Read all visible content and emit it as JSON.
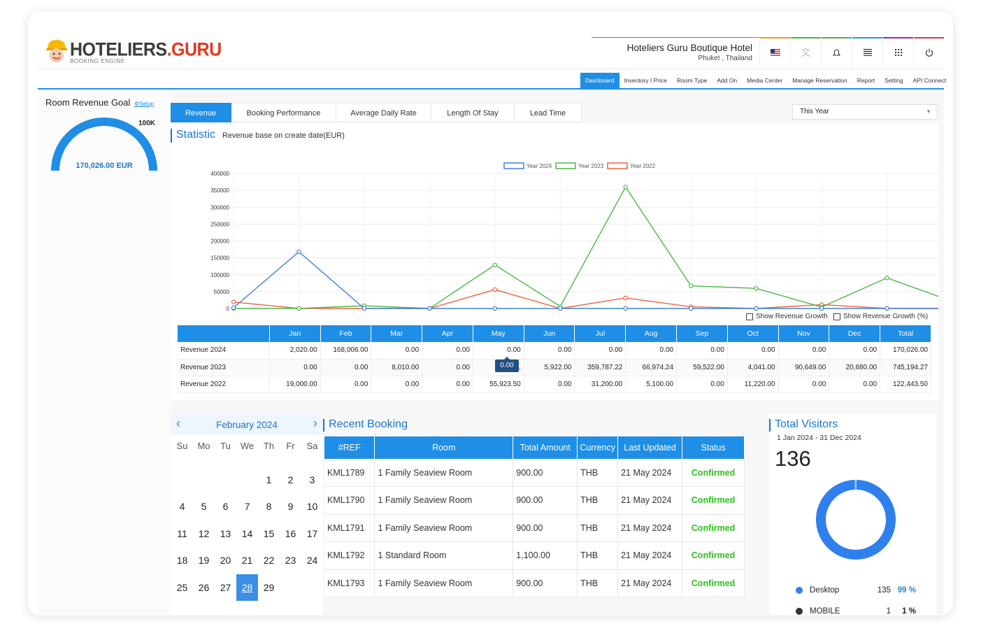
{
  "brand": {
    "name_a": "HOTELIERS",
    "name_b": ".GURU",
    "subtitle": "BOOKING ENGINE"
  },
  "hotel": {
    "name": "Hoteliers Guru Boutique Hotel",
    "location": "Phuket , Thailand"
  },
  "header_icons": [
    {
      "icon": "flag-icon",
      "bar": "#ff9800"
    },
    {
      "icon": "translate-icon",
      "bar": "#4caf50"
    },
    {
      "icon": "bell-icon",
      "bar": "#4caf50"
    },
    {
      "icon": "list-icon",
      "bar": "#2196f3"
    },
    {
      "icon": "apps-grid-icon",
      "bar": "#9c27b0"
    },
    {
      "icon": "power-icon",
      "bar": "#e53935"
    }
  ],
  "nav": [
    "Dashboard",
    "Inventory I Price",
    "Room Type",
    "Add On",
    "Media Center",
    "Manage Reservation",
    "Report",
    "Setting",
    "API Connect"
  ],
  "goal": {
    "title": "Room Revenue Goal",
    "setup": "Setup",
    "max_label": "100K",
    "value_label": "170,026.00 EUR"
  },
  "tabs": [
    "Revenue",
    "Booking Performance",
    "Average Daily Rate",
    "Length Of Stay",
    "Lead Time"
  ],
  "year_select": "This Year",
  "statistic": {
    "title": "Statistic",
    "subtitle": "Revenue base on create date(EUR)"
  },
  "growth": {
    "option1": "Show Revenue Growth",
    "option2": "Show Revenue Growth (%)"
  },
  "chart_data": {
    "type": "line",
    "categories": [
      "Jan",
      "Feb",
      "Mar",
      "Apr",
      "May",
      "Jun",
      "Jul",
      "Aug",
      "Sep",
      "Oct",
      "Nov",
      "Dec"
    ],
    "ylim": [
      0,
      400000
    ],
    "yticks": [
      "0",
      "50000",
      "100000",
      "150000",
      "200000",
      "250000",
      "300000",
      "350000",
      "400000"
    ],
    "legend_position": "top-center",
    "grid": true,
    "series": [
      {
        "name": "Year 2024",
        "color": "#3b82e0",
        "values": [
          2020,
          168006,
          0,
          0,
          0,
          0,
          0,
          0,
          0,
          0,
          0,
          0
        ]
      },
      {
        "name": "Year 2023",
        "color": "#4cb944",
        "values": [
          0,
          0,
          8010,
          0,
          129000,
          5922,
          359787.22,
          66974.24,
          59522,
          4041,
          90649,
          20680
        ]
      },
      {
        "name": "Year 2022",
        "color": "#f0623a",
        "values": [
          19000,
          0,
          0,
          0,
          55923.5,
          0,
          31200,
          5100,
          0,
          11220,
          0,
          0
        ]
      }
    ]
  },
  "rev_table": {
    "headers": [
      "",
      "Jan",
      "Feb",
      "Mar",
      "Apr",
      "May",
      "Jun",
      "Jul",
      "Aug",
      "Sep",
      "Oct",
      "Nov",
      "Dec",
      "Total"
    ],
    "rows": [
      [
        "Revenue 2024",
        "2,020.00",
        "168,006.00",
        "0.00",
        "0.00",
        "0.00",
        "0.00",
        "0.00",
        "0.00",
        "0.00",
        "0.00",
        "0.00",
        "0.00",
        "170,026.00"
      ],
      [
        "Revenue 2023",
        "0.00",
        "0.00",
        "8,010.00",
        "0.00",
        "129,",
        "5,922.00",
        "359,787.22",
        "66,974.24",
        "59,522.00",
        "4,041.00",
        "90,649.00",
        "20,680.00",
        "745,194.27"
      ],
      [
        "Revenue 2022",
        "19,000.00",
        "0.00",
        "0.00",
        "0.00",
        "55,923.50",
        "0.00",
        "31,200.00",
        "5,100.00",
        "0.00",
        "11,220.00",
        "0.00",
        "0.00",
        "122,443.50"
      ]
    ],
    "tooltip": "0.00"
  },
  "calendar": {
    "title": "February 2024",
    "dow": [
      "Su",
      "Mo",
      "Tu",
      "We",
      "Th",
      "Fr",
      "Sa"
    ],
    "days": [
      "",
      "",
      "",
      "",
      "1",
      "2",
      "3",
      "4",
      "5",
      "6",
      "7",
      "8",
      "9",
      "10",
      "11",
      "12",
      "13",
      "14",
      "15",
      "16",
      "17",
      "18",
      "19",
      "20",
      "21",
      "22",
      "23",
      "24",
      "25",
      "26",
      "27",
      "28",
      "29"
    ],
    "selected": "28"
  },
  "recent": {
    "title": "Recent Booking",
    "headers": [
      "#REF",
      "Room",
      "Total Amount",
      "Currency",
      "Last Updated",
      "Status"
    ],
    "rows": [
      [
        "KML1789",
        "1 Family Seaview Room",
        "900.00",
        "THB",
        "21 May 2024",
        "Confirmed"
      ],
      [
        "KML1790",
        "1 Family Seaview Room",
        "900.00",
        "THB",
        "21 May 2024",
        "Confirmed"
      ],
      [
        "KML1791",
        "1 Family Seaview Room",
        "900.00",
        "THB",
        "21 May 2024",
        "Confirmed"
      ],
      [
        "KML1792",
        "1 Standard Room",
        "1,100.00",
        "THB",
        "21 May 2024",
        "Confirmed"
      ],
      [
        "KML1793",
        "1 Family Seaview Room",
        "900.00",
        "THB",
        "21 May 2024",
        "Confirmed"
      ]
    ]
  },
  "visitors": {
    "title": "Total Visitors",
    "range": "1 Jan 2024 - 31 Dec 2024",
    "total": "136",
    "items": [
      {
        "label": "Desktop",
        "count": "135",
        "pct": "99 %",
        "color": "#2f80ed",
        "pct_color": "#1e88e5",
        "value": 135
      },
      {
        "label": "MOBILE",
        "count": "1",
        "pct": "1 %",
        "color": "#333333",
        "pct_color": "#222222",
        "value": 1
      }
    ]
  }
}
